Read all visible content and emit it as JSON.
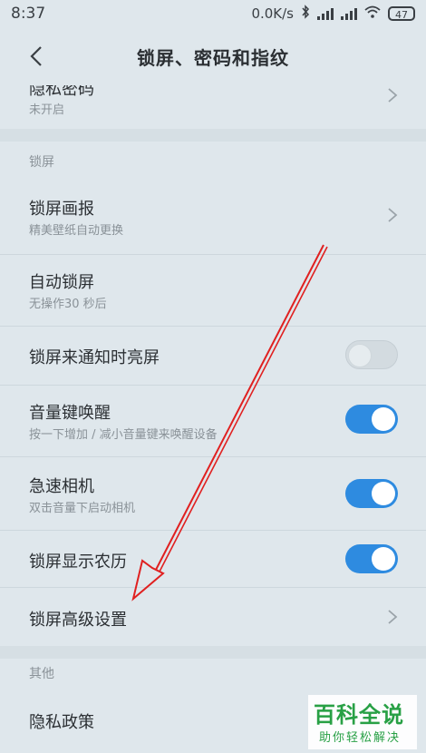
{
  "status": {
    "time": "8:37",
    "speed": "0.0K/s",
    "battery": "47"
  },
  "header": {
    "title": "锁屏、密码和指纹"
  },
  "rows": {
    "privacy_password": {
      "title": "隐私密码",
      "subtitle": "未开启"
    },
    "lock_screen_pictorial": {
      "title": "锁屏画报",
      "subtitle": "精美壁纸自动更换"
    },
    "auto_lock": {
      "title": "自动锁屏",
      "subtitle": "无操作30 秒后"
    },
    "wake_on_notification": {
      "title": "锁屏来通知时亮屏",
      "enabled": false
    },
    "volume_key_wake": {
      "title": "音量键唤醒",
      "subtitle": "按一下增加 / 减小音量键来唤醒设备",
      "enabled": true
    },
    "quick_camera": {
      "title": "急速相机",
      "subtitle": "双击音量下启动相机",
      "enabled": true
    },
    "lunar_calendar": {
      "title": "锁屏显示农历",
      "enabled": true
    },
    "advanced": {
      "title": "锁屏高级设置"
    },
    "privacy_policy": {
      "title": "隐私政策"
    }
  },
  "sections": {
    "lock_screen": "锁屏",
    "other": "其他"
  },
  "watermark": {
    "main": "百科全说",
    "sub": "助你轻松解决"
  },
  "colors": {
    "accent": "#2e8be0",
    "annotation": "#e02020",
    "background": "#dfe7ec"
  }
}
